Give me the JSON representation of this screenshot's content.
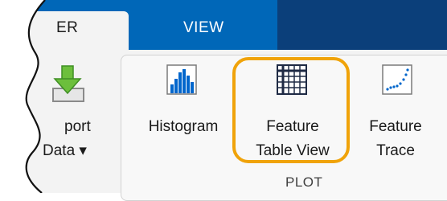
{
  "tabs": [
    {
      "label": "ER",
      "active": true
    },
    {
      "label": "VIEW",
      "active": false
    }
  ],
  "buttons": {
    "import": {
      "line1": "port",
      "line2": "Data ▾"
    },
    "histogram": {
      "line1": "Histogram"
    },
    "feature_table": {
      "line1": "Feature",
      "line2": "Table View"
    },
    "feature_trace": {
      "line1": "Feature",
      "line2": "Trace"
    }
  },
  "group": {
    "label": "PLOT"
  },
  "colors": {
    "tab_blue": "#0067b8",
    "tab_dark": "#0b3f7a",
    "ribbon": "#f3f3f3",
    "highlight": "#f0a30a",
    "icon_blue": "#0066cc",
    "import_green": "#4caf50"
  },
  "icons": {
    "import": "download-arrow-icon",
    "histogram": "histogram-icon",
    "feature_table": "table-grid-icon",
    "feature_trace": "scatter-trace-icon"
  }
}
